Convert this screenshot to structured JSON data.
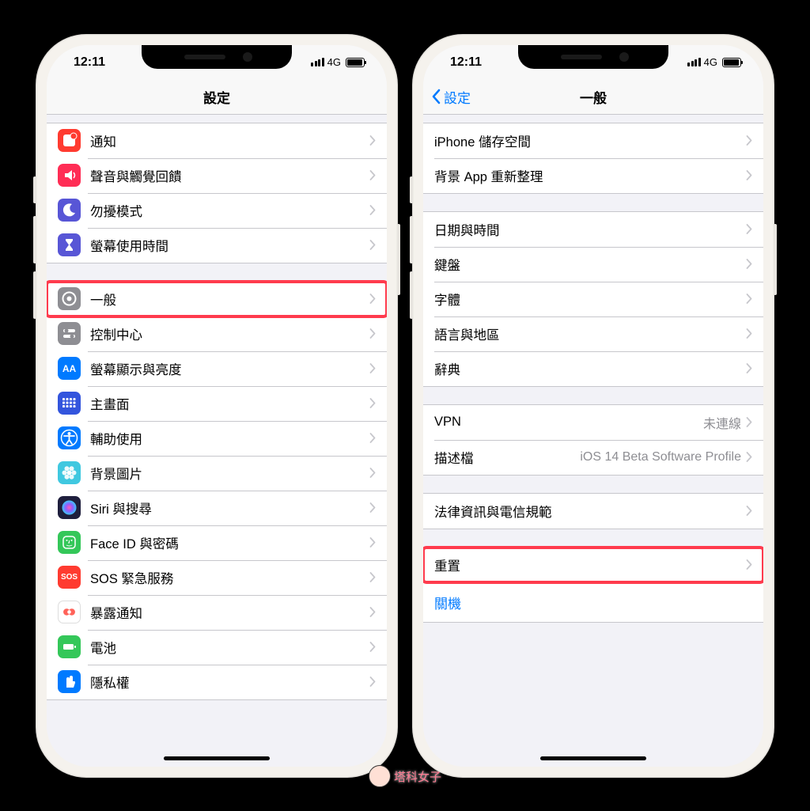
{
  "status": {
    "time": "12:11",
    "network": "4G"
  },
  "left": {
    "title": "設定",
    "groups": [
      {
        "items": [
          {
            "key": "notifications",
            "label": "通知",
            "iconColor": "#ff3b30",
            "iconName": "notifications-icon"
          },
          {
            "key": "sounds",
            "label": "聲音與觸覺回饋",
            "iconColor": "#ff2d55",
            "iconName": "sounds-icon"
          },
          {
            "key": "dnd",
            "label": "勿擾模式",
            "iconColor": "#5856d6",
            "iconName": "moon-icon"
          },
          {
            "key": "screentime",
            "label": "螢幕使用時間",
            "iconColor": "#5856d6",
            "iconName": "hourglass-icon"
          }
        ]
      },
      {
        "items": [
          {
            "key": "general",
            "label": "一般",
            "iconColor": "#8e8e93",
            "iconName": "gear-icon",
            "highlight": true
          },
          {
            "key": "controlcenter",
            "label": "控制中心",
            "iconColor": "#8e8e93",
            "iconName": "switches-icon"
          },
          {
            "key": "display",
            "label": "螢幕顯示與亮度",
            "iconColor": "#007aff",
            "iconName": "text-size-icon",
            "iconText": "AA"
          },
          {
            "key": "homescreen",
            "label": "主畫面",
            "iconColor": "#3355dd",
            "iconName": "grid-icon"
          },
          {
            "key": "accessibility",
            "label": "輔助使用",
            "iconColor": "#007aff",
            "iconName": "accessibility-icon"
          },
          {
            "key": "wallpaper",
            "label": "背景圖片",
            "iconColor": "#40c8e0",
            "iconName": "flower-icon"
          },
          {
            "key": "siri",
            "label": "Siri 與搜尋",
            "iconColor": "#1f1f3d",
            "iconName": "siri-icon"
          },
          {
            "key": "faceid",
            "label": "Face ID 與密碼",
            "iconColor": "#34c759",
            "iconName": "faceid-icon"
          },
          {
            "key": "sos",
            "label": "SOS 緊急服務",
            "iconColor": "#ff3b30",
            "iconName": "sos-icon",
            "iconText": "SOS"
          },
          {
            "key": "exposure",
            "label": "暴露通知",
            "iconColor": "#ffffff",
            "iconName": "exposure-icon",
            "iconBorder": true
          },
          {
            "key": "battery",
            "label": "電池",
            "iconColor": "#34c759",
            "iconName": "battery-icon"
          },
          {
            "key": "privacy",
            "label": "隱私權",
            "iconColor": "#007aff",
            "iconName": "hand-icon"
          }
        ]
      }
    ]
  },
  "right": {
    "back": "設定",
    "title": "一般",
    "groups": [
      {
        "items": [
          {
            "key": "storage",
            "label": "iPhone 儲存空間"
          },
          {
            "key": "bgrefresh",
            "label": "背景 App 重新整理"
          }
        ]
      },
      {
        "items": [
          {
            "key": "datetime",
            "label": "日期與時間"
          },
          {
            "key": "keyboard",
            "label": "鍵盤"
          },
          {
            "key": "fonts",
            "label": "字體"
          },
          {
            "key": "language",
            "label": "語言與地區"
          },
          {
            "key": "dictionary",
            "label": "辭典"
          }
        ]
      },
      {
        "items": [
          {
            "key": "vpn",
            "label": "VPN",
            "detail": "未連線"
          },
          {
            "key": "profiles",
            "label": "描述檔",
            "detail": "iOS 14 Beta Software Profile"
          }
        ]
      },
      {
        "items": [
          {
            "key": "legal",
            "label": "法律資訊與電信規範"
          }
        ]
      },
      {
        "items": [
          {
            "key": "reset",
            "label": "重置",
            "highlight": true
          }
        ]
      }
    ],
    "shutdown": "關機"
  },
  "watermark": "塔科女子"
}
